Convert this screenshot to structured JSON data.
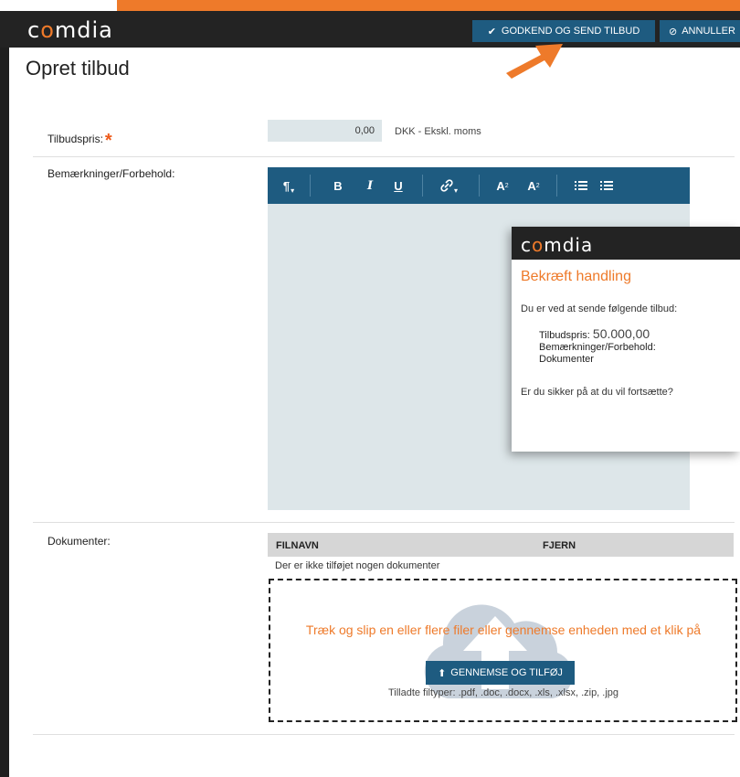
{
  "brand": {
    "logo_pre": "c",
    "logo_o": "o",
    "logo_post": "mdia",
    "accent": "#ee7a2a",
    "primary": "#1e5b80"
  },
  "header": {
    "approve_icon": "checkmark-icon",
    "approve_label": "GODKEND OG SEND TILBUD",
    "cancel_icon": "ban-icon",
    "cancel_label": "ANNULLER"
  },
  "page": {
    "title": "Opret tilbud"
  },
  "form": {
    "price_label": "Tilbudspris:",
    "price_required": "*",
    "price_value": "0,00",
    "price_unit": "DKK - Ekskl. moms",
    "remarks_label": "Bemærkninger/Forbehold:",
    "documents_label": "Dokumenter:"
  },
  "editor": {
    "toolbar": [
      {
        "name": "paragraph-format-icon",
        "glyph": "¶"
      },
      {
        "name": "bold-icon",
        "glyph": "B"
      },
      {
        "name": "italic-icon",
        "glyph": "I"
      },
      {
        "name": "underline-icon",
        "glyph": "U"
      },
      {
        "name": "link-icon",
        "glyph": "🔗"
      },
      {
        "name": "superscript-icon",
        "glyph": "A²"
      },
      {
        "name": "subscript-icon",
        "glyph": "A₂"
      },
      {
        "name": "unordered-list-icon",
        "glyph": "☰"
      },
      {
        "name": "ordered-list-icon",
        "glyph": "☰"
      }
    ]
  },
  "dialog": {
    "title": "Bekræft handling",
    "intro": "Du er ved at sende følgende tilbud:",
    "price_label": "Tilbudspris:",
    "price_value": "50.000,00",
    "remarks_label": "Bemærkninger/Forbehold:",
    "documents_label": "Dokumenter",
    "question": "Er du sikker på at du vil fortsætte?"
  },
  "documents": {
    "col_filename": "FILNAVN",
    "col_remove": "FJERN",
    "empty_text": "Der er ikke tilføjet nogen dokumenter",
    "drop_text": "Træk og slip en eller flere filer eller gennemse enheden med et klik på",
    "browse_icon": "upload-icon",
    "browse_label": "GENNEMSE OG TILFØJ",
    "allowed_types": "Tilladte filtyper: .pdf, .doc, .docx, .xls, .xlsx, .zip, .jpg"
  }
}
